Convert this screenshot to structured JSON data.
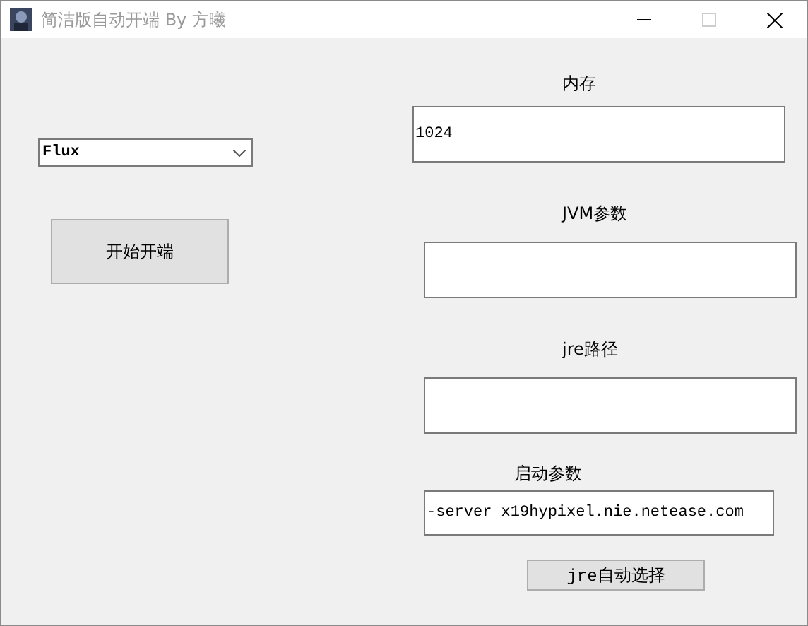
{
  "window": {
    "title": "简洁版自动开端 By 方曦",
    "maximize_disabled": true
  },
  "version_dropdown": {
    "value": "Flux"
  },
  "start_button": {
    "label": "开始开端"
  },
  "fields": [
    {
      "label": "内存",
      "value": "1024"
    },
    {
      "label": "JVM参数"
    },
    {
      "label": "jre路径"
    },
    {
      "label": "启动参数",
      "value": "-server x19hypixel.nie.netease.com"
    }
  ],
  "jre_button": {
    "label": "jre自动选择"
  }
}
